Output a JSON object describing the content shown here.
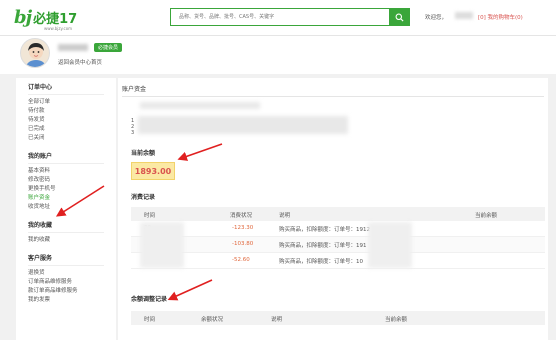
{
  "header": {
    "logo_mark": "bj",
    "logo_text": "必捷17",
    "logo_url": "www.bjzy.com",
    "search_placeholder": "品称、货号、品牌、批号、CAS号、关键字",
    "welcome": "欢迎您，",
    "cart_label": "[0] 我的购物车(0)"
  },
  "profile": {
    "vip_badge": "必捷会员",
    "back_link": "返回会员中心首页"
  },
  "sidebar": {
    "groups": [
      {
        "title": "订单中心",
        "items": [
          "全部订单",
          "待付款",
          "待发货",
          "已完成",
          "已关闭"
        ]
      },
      {
        "title": "我的账户",
        "items": [
          "基本资料",
          "修改密码",
          "更换手机号",
          "账户资金",
          "收货地址"
        ]
      },
      {
        "title": "我的收藏",
        "items": [
          "我的收藏"
        ]
      },
      {
        "title": "客户服务",
        "items": [
          "退换货",
          "订单商品维修服务",
          "款订单商品维修服务",
          "我的发票"
        ]
      }
    ]
  },
  "main": {
    "title": "账户资金",
    "list_nums": [
      "1",
      "2",
      "3"
    ],
    "balance_label": "当前余额",
    "balance_value": "1893.00",
    "records_label": "消费记录",
    "records_headers": [
      "时间",
      "消费状况",
      "说明",
      "当前余额"
    ],
    "records": [
      {
        "time": "20",
        "amount": "-123.30",
        "desc": "购买商品，扣除额度：订单号：1912"
      },
      {
        "time": "20",
        "amount": "-103.80",
        "desc": "购买商品，扣除额度：订单号：191"
      },
      {
        "time": "20",
        "amount": "-52.60",
        "desc": "购买商品，扣除额度：订单号：10"
      }
    ],
    "adjust_label": "余额调整记录",
    "adjust_headers": [
      "时间",
      "余额状况",
      "说明",
      "当前余额"
    ]
  },
  "colors": {
    "brand_green": "#3aa63a",
    "negative": "#e0673c",
    "annotation_red": "#e02020"
  },
  "icons": {
    "search": "search-icon",
    "avatar": "avatar",
    "arrow": "red-annotation-arrow"
  }
}
